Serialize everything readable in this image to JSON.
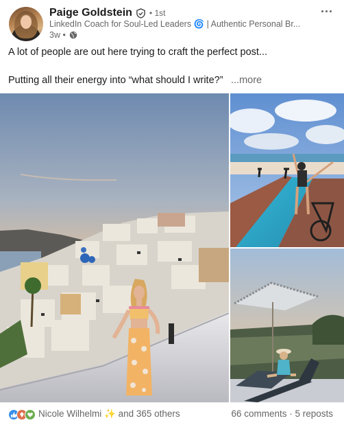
{
  "post": {
    "author_name": "Paige Goldstein",
    "degree": "• 1st",
    "headline": "LinkedIn Coach for Soul-Led Leaders 🌀 | Authentic Personal Br...",
    "time": "3w •",
    "text_line1": "A lot of people are out here trying to craft the perfect post...",
    "text_line2": "Putting all their energy into “what should I write?”",
    "see_more": "...more"
  },
  "social": {
    "liker_name": "Nicole Wilhelmi",
    "sparkle": "✨",
    "others": "and 365 others",
    "counts": "66 comments · 5 reposts"
  },
  "icons": {
    "verify": "verified-shield-icon",
    "globe": "globe-icon",
    "more": "ellipsis-icon"
  },
  "colors": {
    "like": "#378fe9",
    "celebrate": "#df704d",
    "support": "#6dae4f"
  }
}
